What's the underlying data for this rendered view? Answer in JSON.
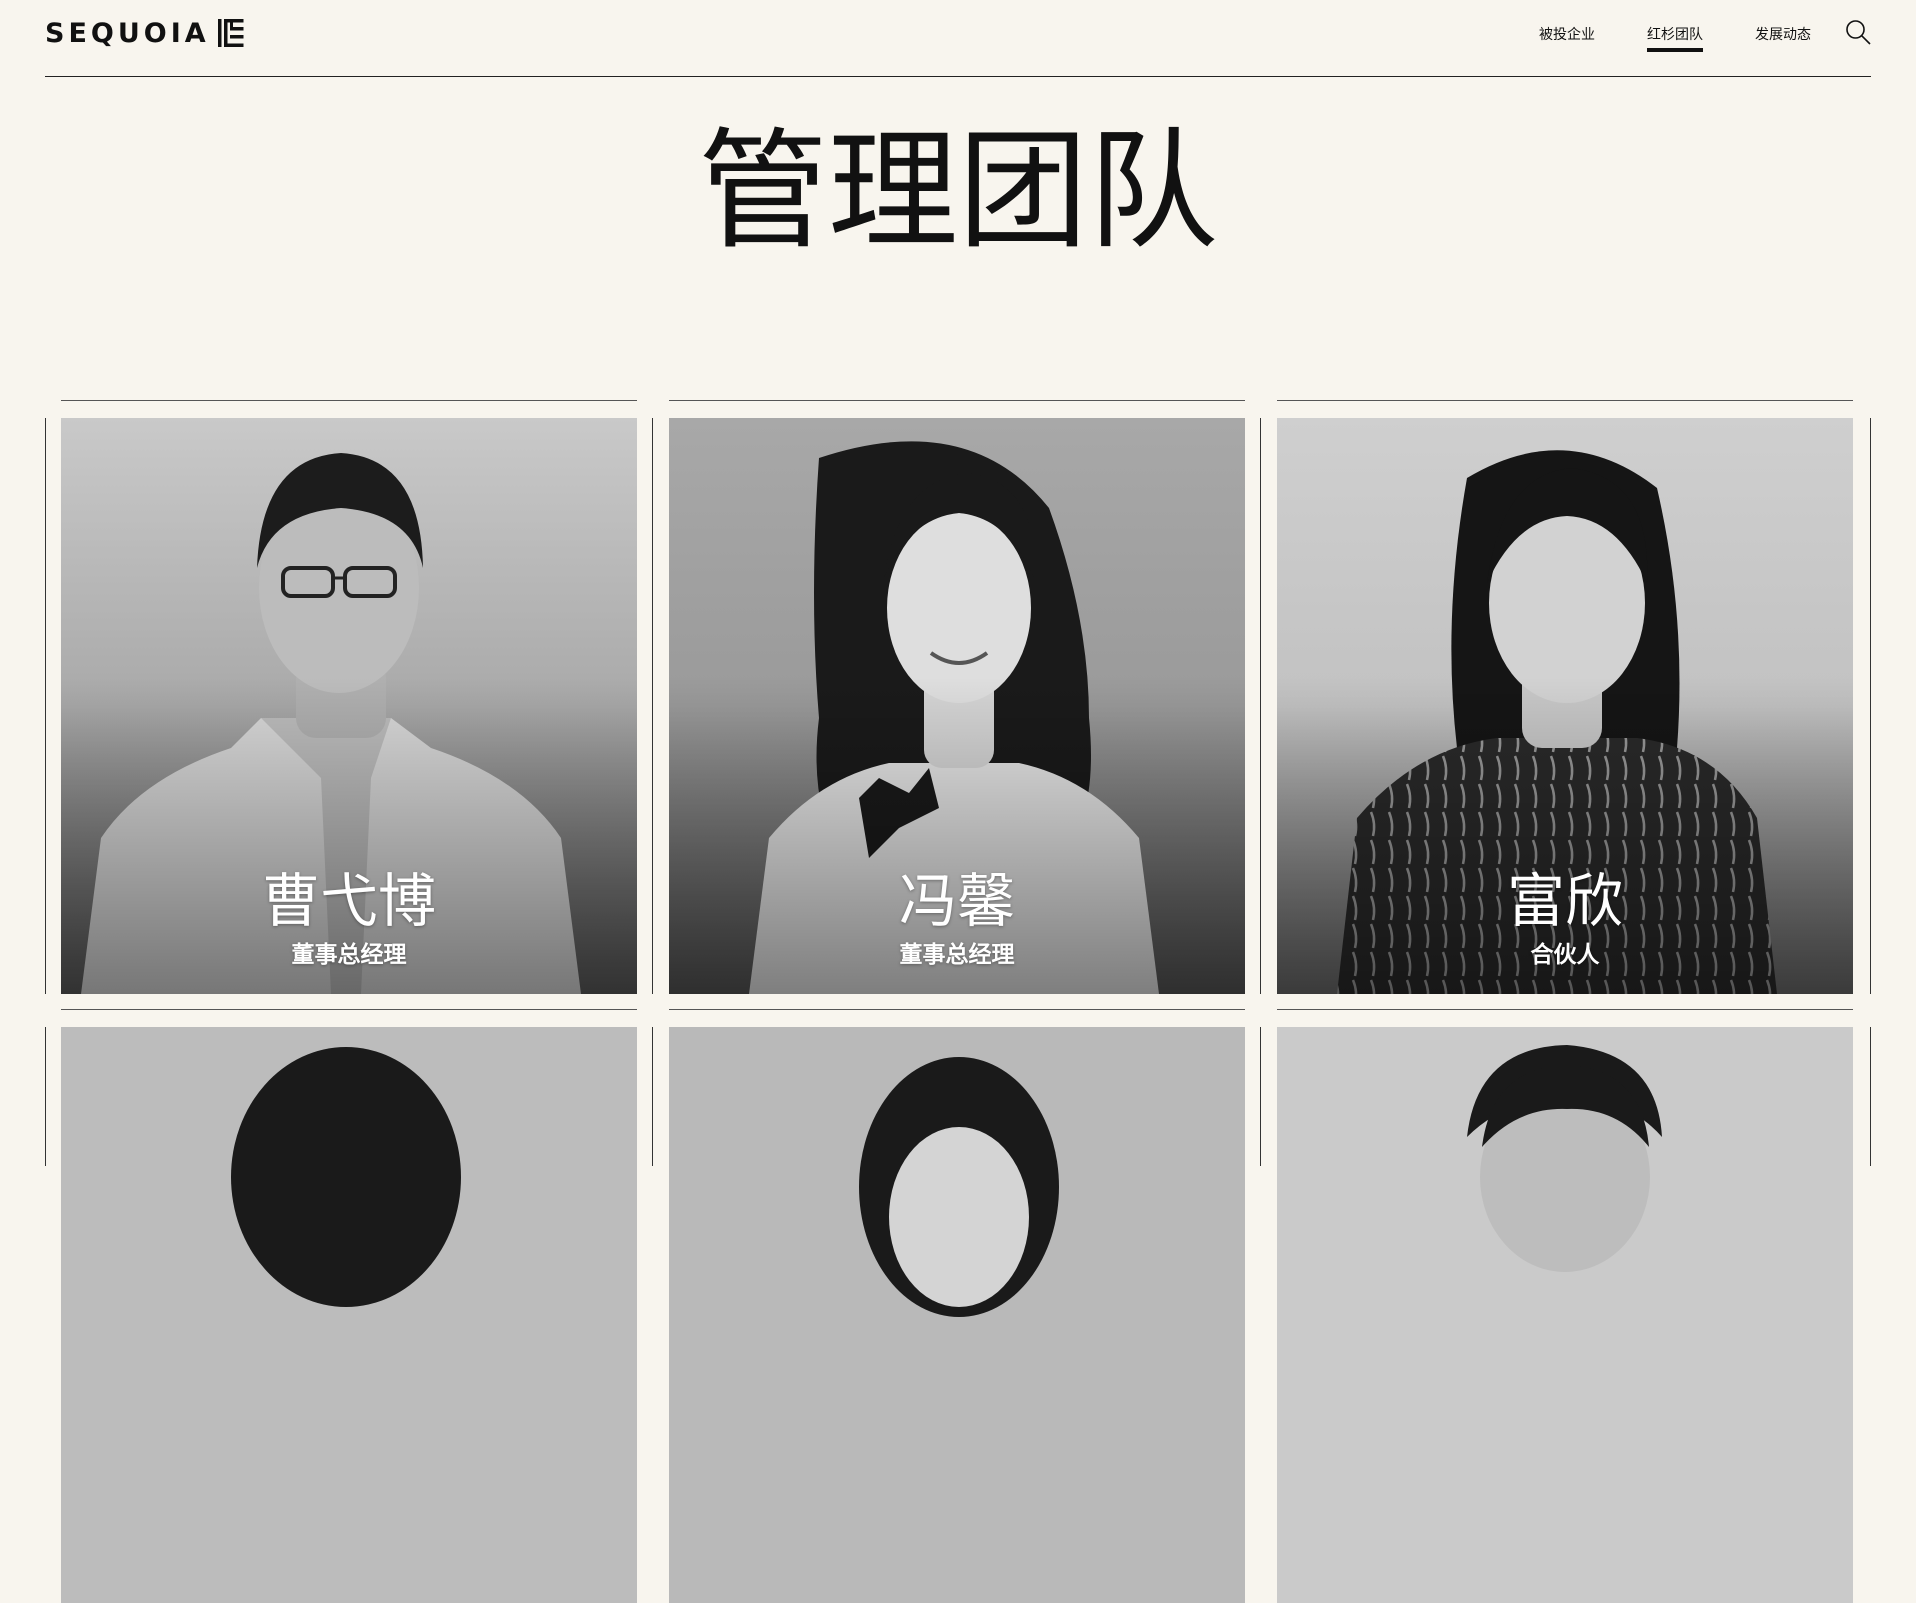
{
  "header": {
    "logo_text": "SEQUOIA",
    "logo_icon": "sequoia-mark",
    "nav": [
      {
        "label": "被投企业",
        "active": false
      },
      {
        "label": "红杉团队",
        "active": true
      },
      {
        "label": "发展动态",
        "active": false
      }
    ],
    "search_icon": "search-icon"
  },
  "page": {
    "title": "管理团队"
  },
  "team": [
    {
      "name": "曹弋博",
      "role": "董事总经理"
    },
    {
      "name": "冯馨",
      "role": "董事总经理"
    },
    {
      "name": "富欣",
      "role": "合伙人"
    },
    {
      "name": "",
      "role": ""
    },
    {
      "name": "",
      "role": ""
    },
    {
      "name": "",
      "role": ""
    }
  ],
  "colors": {
    "background": "#f8f5ee",
    "text": "#111111",
    "caption": "#ffffff"
  }
}
